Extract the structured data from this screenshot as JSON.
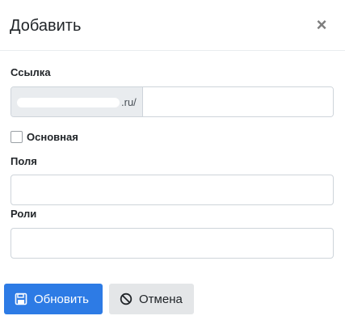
{
  "modal": {
    "title": "Добавить",
    "close_glyph": "×"
  },
  "link_field": {
    "label": "Ссылка",
    "prefix_suffix": ".ru/",
    "value": "",
    "placeholder": ""
  },
  "main_checkbox": {
    "label": "Основная",
    "checked": false
  },
  "fields_field": {
    "label": "Поля",
    "value": "",
    "placeholder": ""
  },
  "roles_field": {
    "label": "Роли",
    "value": "",
    "placeholder": ""
  },
  "buttons": {
    "update_label": "Обновить",
    "update_icon": "save-icon",
    "cancel_label": "Отмена",
    "cancel_icon": "ban-icon"
  },
  "colors": {
    "primary": "#2d7be5",
    "secondary": "#e4e6e8"
  }
}
